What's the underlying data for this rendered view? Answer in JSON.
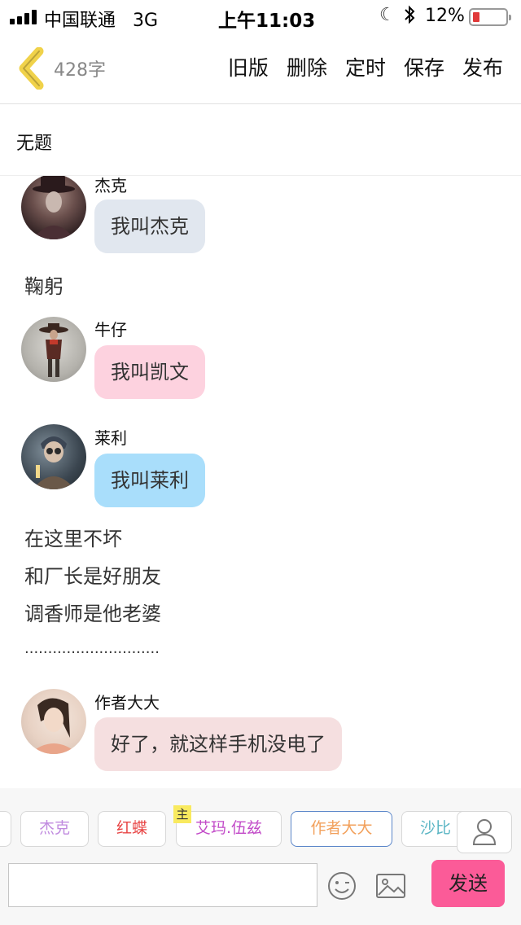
{
  "status_bar": {
    "carrier": "中国联通",
    "network": "3G",
    "time": "上午11:03",
    "battery": "12%",
    "battery_level": 0.12,
    "battery_color": "#e03a3a"
  },
  "nav": {
    "word_count": "428字",
    "actions": [
      "旧版",
      "删除",
      "定时",
      "保存",
      "发布"
    ]
  },
  "title": "无题",
  "messages": [
    {
      "speaker": "杰克",
      "text": "我叫杰克",
      "bubble_color": "#e1e7ef"
    },
    {
      "speaker": "牛仔",
      "text": "我叫凯文",
      "bubble_color": "#fdd2df"
    },
    {
      "speaker": "莱利",
      "text": "我叫莱利",
      "bubble_color": "#a9defb"
    },
    {
      "speaker": "作者大大",
      "text": "好了，就这样手机没电了",
      "bubble_color": "#f5dfe0"
    }
  ],
  "narration": [
    "鞠躬",
    "在这里不坏",
    "和厂长是好朋友",
    "调香师是他老婆",
    "............................."
  ],
  "character_chips": [
    {
      "label": "杰克",
      "color": "#c08adf"
    },
    {
      "label": "红蝶",
      "color": "#e84646"
    },
    {
      "label": "艾玛.伍兹",
      "color": "#c24ac8",
      "badge": "主"
    },
    {
      "label": "作者大大",
      "color": "#f2a05b",
      "border": "#5b86c9"
    },
    {
      "label": "沙比",
      "color": "#5ab5c4"
    }
  ],
  "composer": {
    "input_value": "",
    "send_label": "发送",
    "accent": "#fb5b98"
  },
  "icons": [
    "back-chevron-icon",
    "emoji-icon",
    "image-icon",
    "user-icon"
  ]
}
